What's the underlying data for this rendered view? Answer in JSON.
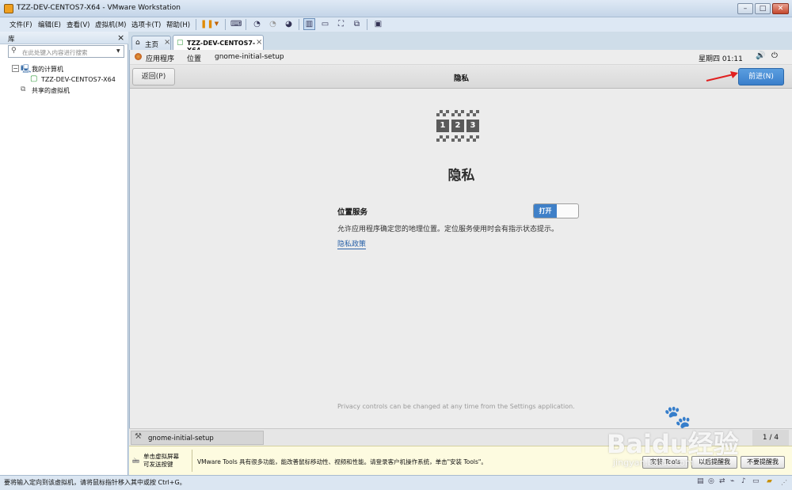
{
  "window": {
    "title": "TZZ-DEV-CENTOS7-X64 - VMware Workstation",
    "controls": {
      "minimize": "–",
      "maximize": "□",
      "close": "✕"
    }
  },
  "menubar": {
    "items": [
      "文件(F)",
      "编辑(E)",
      "查看(V)",
      "虚拟机(M)",
      "选项卡(T)",
      "帮助(H)"
    ]
  },
  "sidebar": {
    "title": "库",
    "close": "×",
    "search_placeholder": "在此处键入内容进行搜索",
    "tree": {
      "my_computer": "我的计算机",
      "vm": "TZZ-DEV-CENTOS7-X64",
      "shared": "共享的虚拟机"
    }
  },
  "tabs": [
    {
      "label": "主页",
      "close": "×"
    },
    {
      "label": "TZZ-DEV-CENTOS7-X64",
      "close": "×"
    }
  ],
  "gnome": {
    "topbar": {
      "apps": "应用程序",
      "places": "位置",
      "app_name": "gnome-initial-setup",
      "clock": "星期四 01:11"
    },
    "header": {
      "back": "返回(P)",
      "title": "隐私",
      "next": "前进(N)"
    },
    "page": {
      "logo_digits": [
        "1",
        "2",
        "3"
      ],
      "heading": "隐私",
      "location_label": "位置服务",
      "toggle_on": "打开",
      "description": "允许应用程序确定您的地理位置。定位服务使用时会有指示状态提示。",
      "policy_link": "隐私政策",
      "footer": "Privacy controls can be changed at any time from the Settings application."
    }
  },
  "vm_status": {
    "app": "gnome-initial-setup",
    "page_counter": "1 / 4"
  },
  "tools_bar": {
    "hint_line1": "单击虚拟屏幕",
    "hint_line2": "可发送按键",
    "message": "VMware Tools 具有很多功能，能改善鼠标移动性、视频和性能。请登录客户机操作系统，单击\"安装 Tools\"。",
    "install_btn": "安装 Tools",
    "remind_btn": "以后提醒我",
    "never_btn": "不要提醒我"
  },
  "statusbar": {
    "text": "要将输入定向到该虚拟机，请将鼠标指针移入其中或按 Ctrl+G。"
  },
  "watermark": {
    "brand": "Baidu经验",
    "url": "jingyan.baidu.com"
  },
  "colors": {
    "accent": "#3a7fcb",
    "annotation_arrow": "#e02020"
  }
}
